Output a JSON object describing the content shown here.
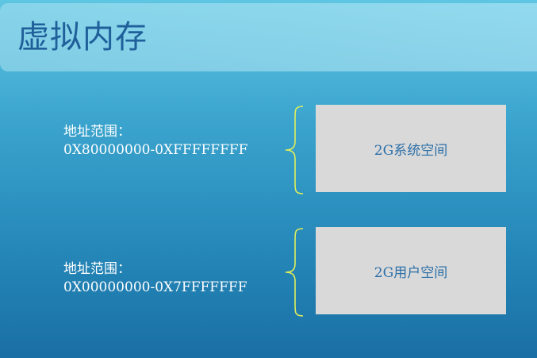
{
  "slide": {
    "title": "虚拟内存"
  },
  "regions": [
    {
      "label": "地址范围：",
      "range": "0X80000000-0XFFFFFFFF",
      "space": "2G系统空间"
    },
    {
      "label": "地址范围：",
      "range": "0X00000000-0X7FFFFFFF",
      "space": "2G用户空间"
    }
  ],
  "colors": {
    "brace": "#e0ef5a",
    "box": "#d9d9d9",
    "box_text": "#2b6fa8",
    "title_text": "#1f5f9a"
  }
}
